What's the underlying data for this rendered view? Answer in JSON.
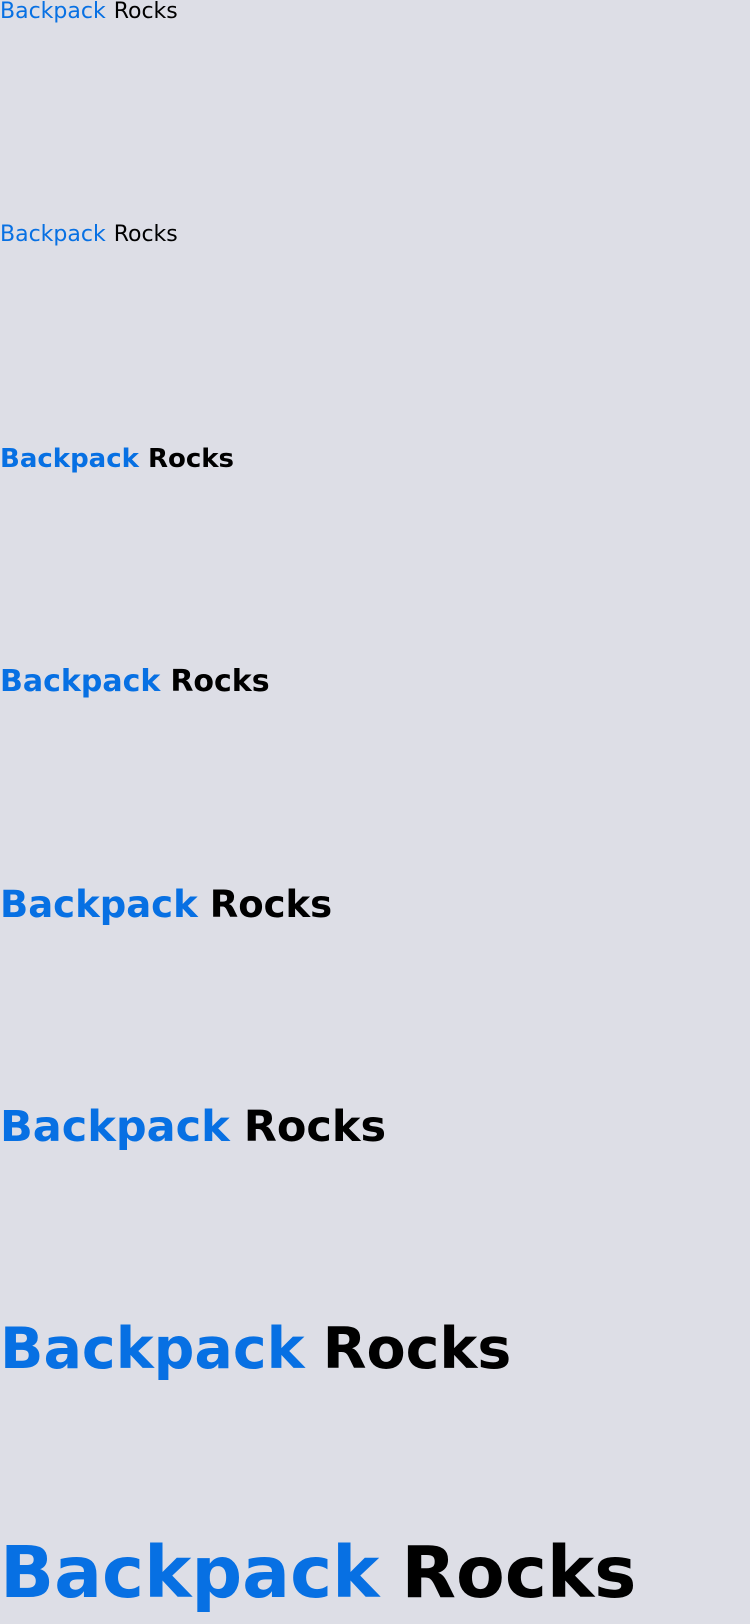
{
  "colors": {
    "background": "#dddee6",
    "link": "#0770e3",
    "text": "#000000"
  },
  "rows": [
    {
      "link_text": "Backpack",
      "text": "Rocks"
    },
    {
      "link_text": "Backpack",
      "text": "Rocks"
    },
    {
      "link_text": "Backpack",
      "text": "Rocks"
    },
    {
      "link_text": "Backpack",
      "text": "Rocks"
    },
    {
      "link_text": "Backpack",
      "text": "Rocks"
    },
    {
      "link_text": "Backpack",
      "text": "Rocks"
    },
    {
      "link_text": "Backpack",
      "text": "Rocks"
    },
    {
      "link_text": "Backpack",
      "text": "Rocks"
    }
  ]
}
